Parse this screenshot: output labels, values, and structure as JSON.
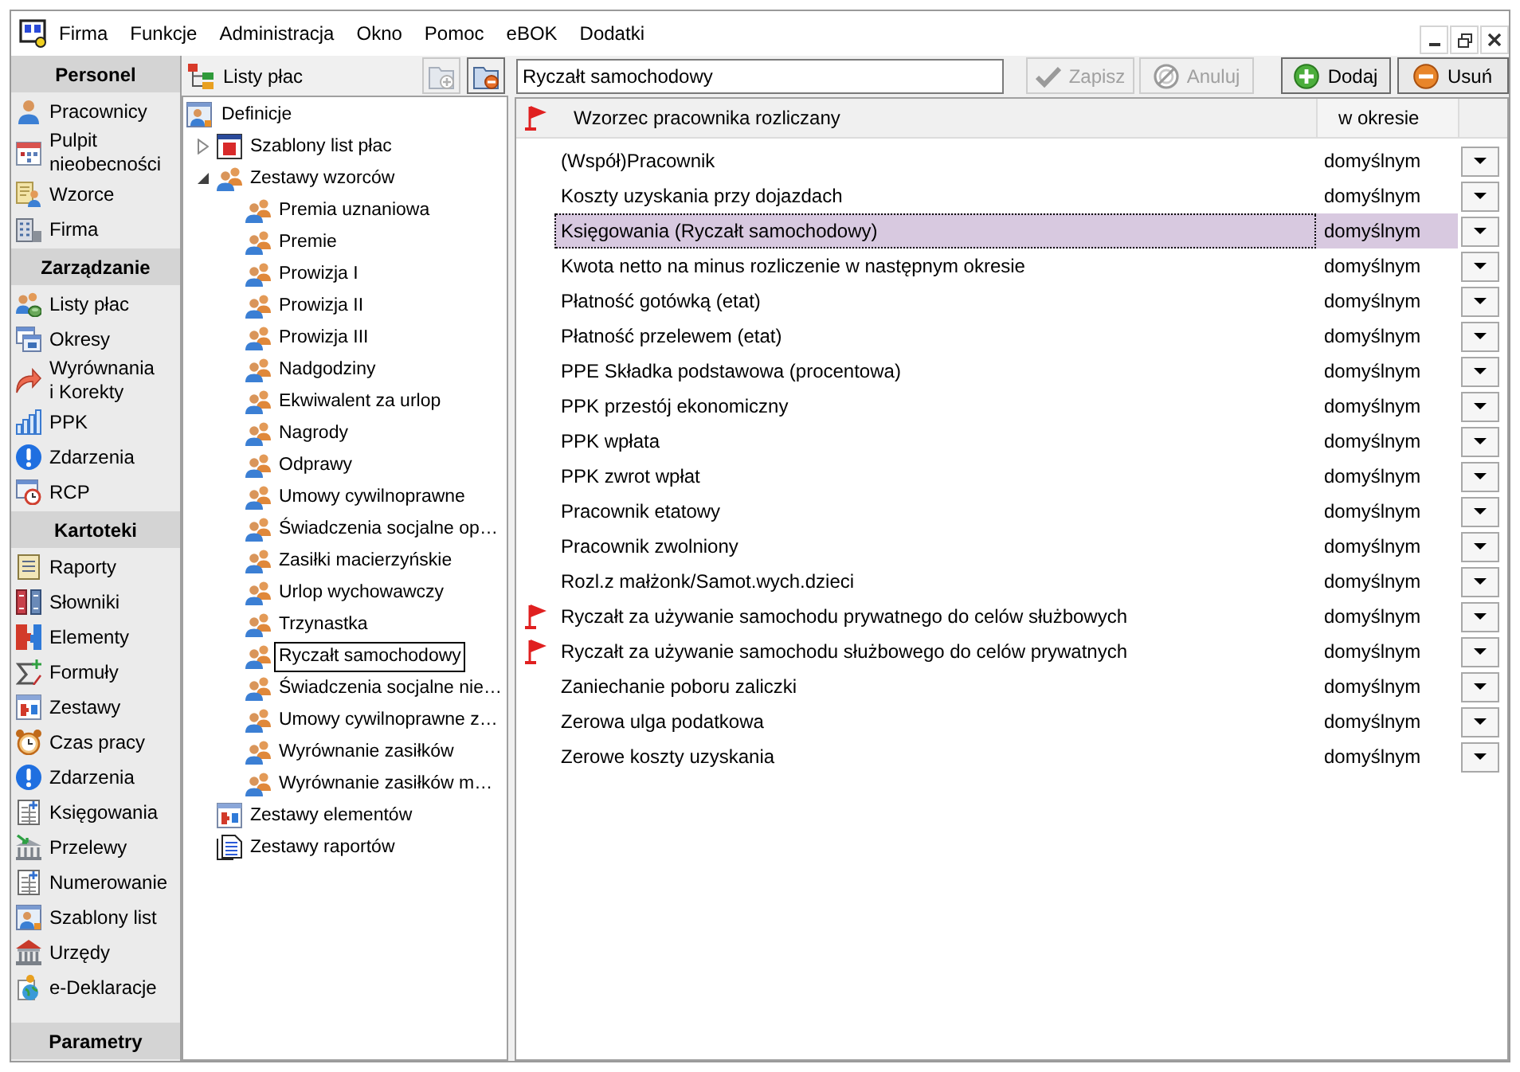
{
  "window": {
    "menu": [
      "Firma",
      "Funkcje",
      "Administracja",
      "Okno",
      "Pomoc",
      "eBOK",
      "Dodatki"
    ]
  },
  "sidebar": {
    "sections": [
      {
        "title": "Personel",
        "items": [
          "Pracownicy",
          "Pulpit\nnieobecności",
          "Wzorce",
          "Firma"
        ]
      },
      {
        "title": "Zarządzanie",
        "items": [
          "Listy płac",
          "Okresy",
          "Wyrównania\ni Korekty",
          "PPK",
          "Zdarzenia",
          "RCP"
        ]
      },
      {
        "title": "Kartoteki",
        "items": [
          "Raporty",
          "Słowniki",
          "Elementy",
          "Formuły",
          "Zestawy",
          "Czas pracy",
          "Zdarzenia",
          "Księgowania",
          "Przelewy",
          "Numerowanie",
          "Szablony list",
          "Urzędy",
          "e-Deklaracje"
        ]
      },
      {
        "title": "Parametry"
      }
    ]
  },
  "tree_panel": {
    "title": "Listy płac",
    "buttons": [
      {
        "disabled": true
      },
      {
        "disabled": false
      }
    ],
    "tree": {
      "label": "Definicje",
      "selected": false,
      "children": [
        {
          "label": "Szablony list płac",
          "expanded": false,
          "selected": false
        },
        {
          "label": "Zestawy wzorców",
          "expanded": true,
          "selected": false,
          "children": [
            {
              "label": "Premia uznaniowa",
              "selected": false
            },
            {
              "label": "Premie",
              "selected": false
            },
            {
              "label": "Prowizja I",
              "selected": false
            },
            {
              "label": "Prowizja II",
              "selected": false
            },
            {
              "label": "Prowizja III",
              "selected": false
            },
            {
              "label": "Nadgodziny",
              "selected": false
            },
            {
              "label": "Ekwiwalent za urlop",
              "selected": false
            },
            {
              "label": "Nagrody",
              "selected": false
            },
            {
              "label": "Odprawy",
              "selected": false
            },
            {
              "label": "Umowy cywilnoprawne",
              "selected": false
            },
            {
              "label": "Świadczenia socjalne op…",
              "selected": false
            },
            {
              "label": "Zasiłki macierzyńskie",
              "selected": false
            },
            {
              "label": "Urlop wychowawczy",
              "selected": false
            },
            {
              "label": "Trzynastka",
              "selected": false
            },
            {
              "label": "Ryczałt samochodowy",
              "selected": true
            },
            {
              "label": "Świadczenia socjalne nie…",
              "selected": false
            },
            {
              "label": "Umowy cywilnoprawne z…",
              "selected": false
            },
            {
              "label": "Wyrównanie zasiłków",
              "selected": false
            },
            {
              "label": "Wyrównanie zasiłków m…",
              "selected": false
            }
          ]
        },
        {
          "label": "Zestawy elementów",
          "selected": false
        },
        {
          "label": "Zestawy raportów",
          "selected": false
        }
      ]
    }
  },
  "editor": {
    "name_field": {
      "value": "Ryczałt samochodowy"
    },
    "buttons": [
      {
        "label": "Zapisz",
        "disabled": true
      },
      {
        "label": "Anuluj",
        "disabled": true
      },
      {
        "label": "Dodaj",
        "disabled": false
      },
      {
        "label": "Usuń",
        "disabled": false
      }
    ]
  },
  "table": {
    "columns": [
      "Wzorzec pracownika rozliczany",
      "w okresie"
    ],
    "rows": [
      {
        "name": "(Współ)Pracownik",
        "period": "domyślnym",
        "flagged": false,
        "selected": false
      },
      {
        "name": "Koszty uzyskania przy dojazdach",
        "period": "domyślnym",
        "flagged": false,
        "selected": false
      },
      {
        "name": "Księgowania (Ryczałt samochodowy)",
        "period": "domyślnym",
        "flagged": false,
        "selected": true
      },
      {
        "name": "Kwota netto na minus rozliczenie w następnym okresie",
        "period": "domyślnym",
        "flagged": false,
        "selected": false
      },
      {
        "name": "Płatność gotówką (etat)",
        "period": "domyślnym",
        "flagged": false,
        "selected": false
      },
      {
        "name": "Płatność przelewem (etat)",
        "period": "domyślnym",
        "flagged": false,
        "selected": false
      },
      {
        "name": "PPE Składka podstawowa (procentowa)",
        "period": "domyślnym",
        "flagged": false,
        "selected": false
      },
      {
        "name": "PPK przestój ekonomiczny",
        "period": "domyślnym",
        "flagged": false,
        "selected": false
      },
      {
        "name": "PPK wpłata",
        "period": "domyślnym",
        "flagged": false,
        "selected": false
      },
      {
        "name": "PPK zwrot wpłat",
        "period": "domyślnym",
        "flagged": false,
        "selected": false
      },
      {
        "name": "Pracownik etatowy",
        "period": "domyślnym",
        "flagged": false,
        "selected": false
      },
      {
        "name": "Pracownik zwolniony",
        "period": "domyślnym",
        "flagged": false,
        "selected": false
      },
      {
        "name": "Rozl.z małżonk/Samot.wych.dzieci",
        "period": "domyślnym",
        "flagged": false,
        "selected": false
      },
      {
        "name": "Ryczałt za używanie samochodu prywatnego do celów służbowych",
        "period": "domyślnym",
        "flagged": true,
        "selected": false
      },
      {
        "name": "Ryczałt za używanie samochodu służbowego do celów prywatnych",
        "period": "domyślnym",
        "flagged": true,
        "selected": false
      },
      {
        "name": "Zaniechanie poboru zaliczki",
        "period": "domyślnym",
        "flagged": false,
        "selected": false
      },
      {
        "name": "Zerowa ulga podatkowa",
        "period": "domyślnym",
        "flagged": false,
        "selected": false
      },
      {
        "name": "Zerowe koszty uzyskania",
        "period": "domyślnym",
        "flagged": false,
        "selected": false
      }
    ]
  }
}
